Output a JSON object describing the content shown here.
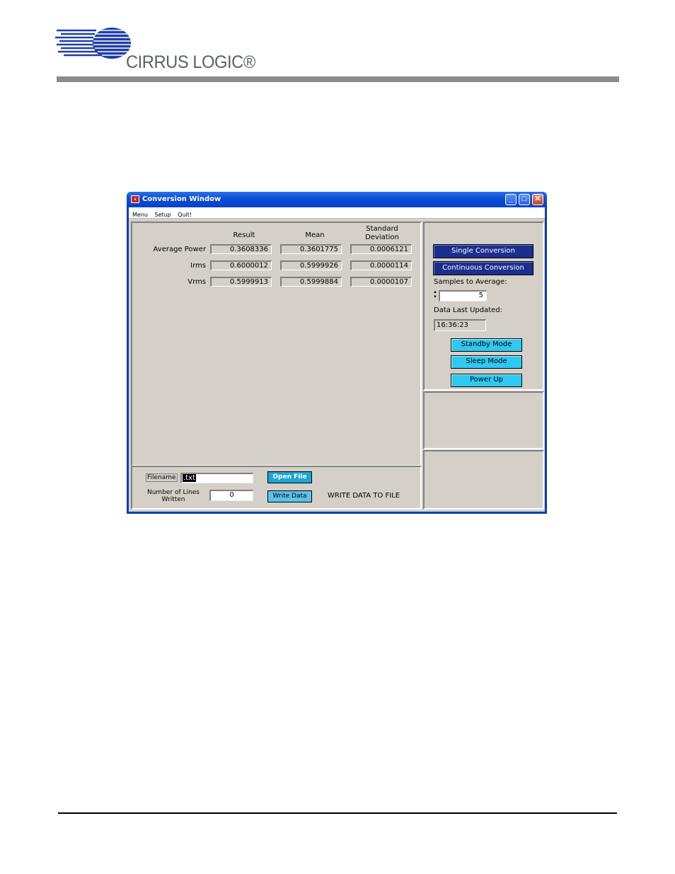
{
  "logo": {
    "text": "CIRRUS LOGIC®"
  },
  "window": {
    "title": "Conversion Window",
    "menu": [
      "Menu",
      "Setup",
      "Quit!"
    ],
    "columns": [
      "Result",
      "Mean",
      "Standard Deviation"
    ],
    "rows": [
      {
        "label": "Average Power",
        "result": "0.3608336",
        "mean": "0.3601775",
        "stdev": "0.0006121"
      },
      {
        "label": "Irms",
        "result": "0.6000012",
        "mean": "0.5999926",
        "stdev": "0.0000114"
      },
      {
        "label": "Vrms",
        "result": "0.5999913",
        "mean": "0.5999884",
        "stdev": "0.0000107"
      }
    ],
    "controls": {
      "single_conversion": "Single Conversion",
      "continuous_conversion": "Continuous Conversion",
      "samples_label": "Samples to Average:",
      "samples_value": "5",
      "last_updated_label": "Data Last Updated:",
      "last_updated_value": "16:36:23",
      "standby": "Standby Mode",
      "sleep": "Sleep Mode",
      "power_up": "Power Up"
    },
    "file": {
      "filename_label": "Filename",
      "filename_value": ".txt",
      "open_file": "Open File",
      "lines_label_1": "Number of Lines",
      "lines_label_2": "Written",
      "lines_value": "0",
      "write_data": "Write Data",
      "status": "WRITE DATA TO FILE"
    }
  }
}
